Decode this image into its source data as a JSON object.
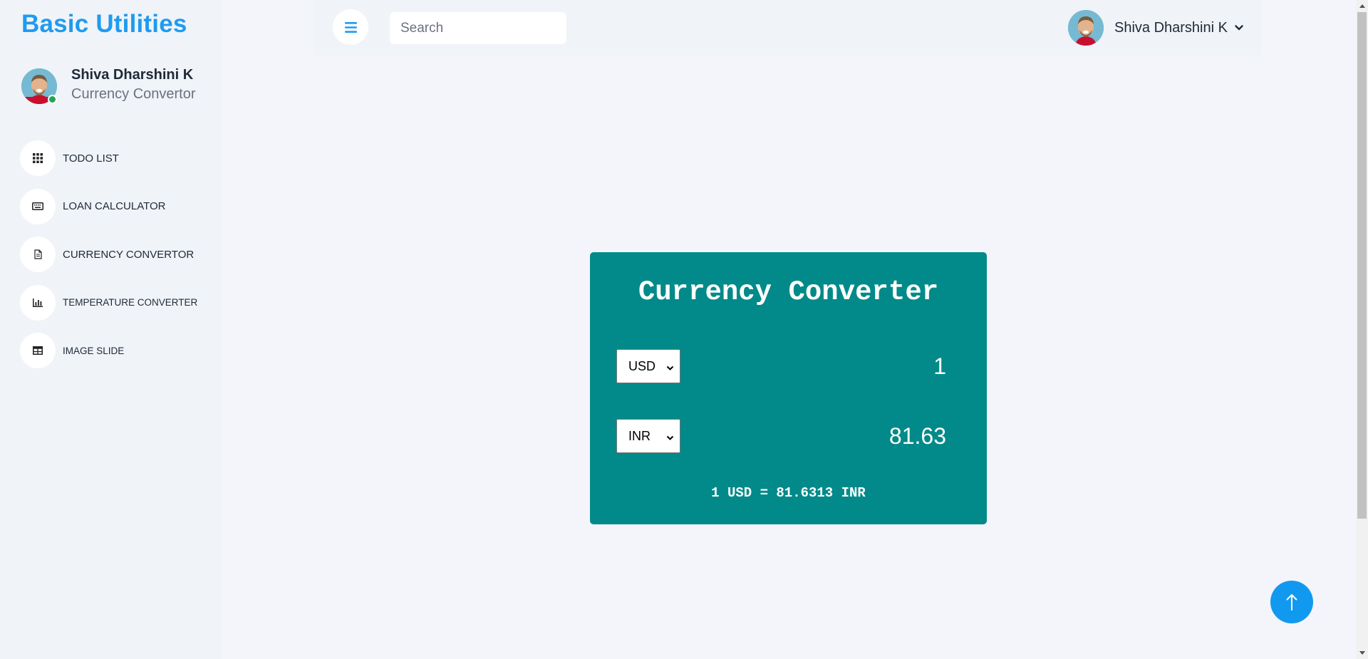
{
  "brand": {
    "title": "Basic Utilities"
  },
  "profile": {
    "name": "Shiva Dharshini K",
    "role": "Currency Convertor"
  },
  "nav": {
    "items": [
      {
        "label": "TODO LIST",
        "icon": "grid-icon"
      },
      {
        "label": "LOAN CALCULATOR",
        "icon": "keyboard-icon"
      },
      {
        "label": "CURRENCY CONVERTOR",
        "icon": "document-icon"
      },
      {
        "label": "TEMPERATURE CONVERTER",
        "icon": "bar-chart-icon"
      },
      {
        "label": "IMAGE SLIDE",
        "icon": "table-icon"
      }
    ]
  },
  "header": {
    "search_placeholder": "Search",
    "user_name": "Shiva Dharshini K"
  },
  "converter": {
    "title": "Currency Converter",
    "from_currency": "USD",
    "from_amount": "1",
    "to_currency": "INR",
    "to_amount": "81.63",
    "rate_text": "1 USD = 81.6313 INR"
  },
  "colors": {
    "brand": "#1e9bf0",
    "card": "#018a89",
    "accent": "#1199f0",
    "online": "#23a455"
  }
}
